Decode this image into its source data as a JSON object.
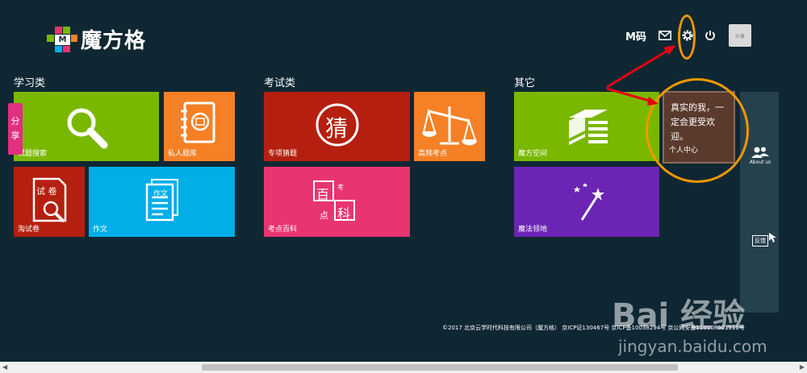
{
  "app": {
    "logo_text": "魔方格"
  },
  "header": {
    "mcode_label": "M码",
    "icons": [
      "mail-icon",
      "gear-icon",
      "power-icon"
    ],
    "avatar_text": "头像"
  },
  "sections": {
    "study": {
      "title": "学习类",
      "tiles": [
        {
          "label": "试题搜索",
          "color": "#7ab800"
        },
        {
          "label": "私人题库",
          "color": "#f58025"
        },
        {
          "label": "淘试卷",
          "color": "#b51f0f"
        },
        {
          "label": "作文",
          "color": "#00aee8"
        }
      ],
      "icon_texts": {
        "exam": "试 卷",
        "essay": "作文"
      }
    },
    "exam": {
      "title": "考试类",
      "tiles": [
        {
          "label": "专项猜题",
          "color": "#b51f0f"
        },
        {
          "label": "高频考点",
          "color": "#f58025"
        },
        {
          "label": "考点百科",
          "color": "#e8356f"
        }
      ],
      "icon_texts": {
        "guess": "猜",
        "bai": "百",
        "kao": "考",
        "dian": "点",
        "ke": "科"
      }
    },
    "other": {
      "title": "其它",
      "tiles": [
        {
          "label": "魔方空间",
          "color": "#7ab800"
        },
        {
          "label": "魔法领地",
          "color": "#6b24b4"
        }
      ]
    }
  },
  "share_tab": {
    "line1": "分",
    "line2": "享"
  },
  "tooltip": {
    "text": "真实的我，一定会更受欢迎。",
    "sub": "个人中心"
  },
  "side_panel": {
    "about": "About us",
    "feedback": "反馈"
  },
  "footer": {
    "text": "©2017 北京云学时代科技有限公司（魔方格） 京ICP证130467号 京ICP备10038294号 京公网安备110108001511号"
  },
  "watermark": {
    "main": "Bai 经验",
    "sub": "jingyan.baidu.com"
  }
}
